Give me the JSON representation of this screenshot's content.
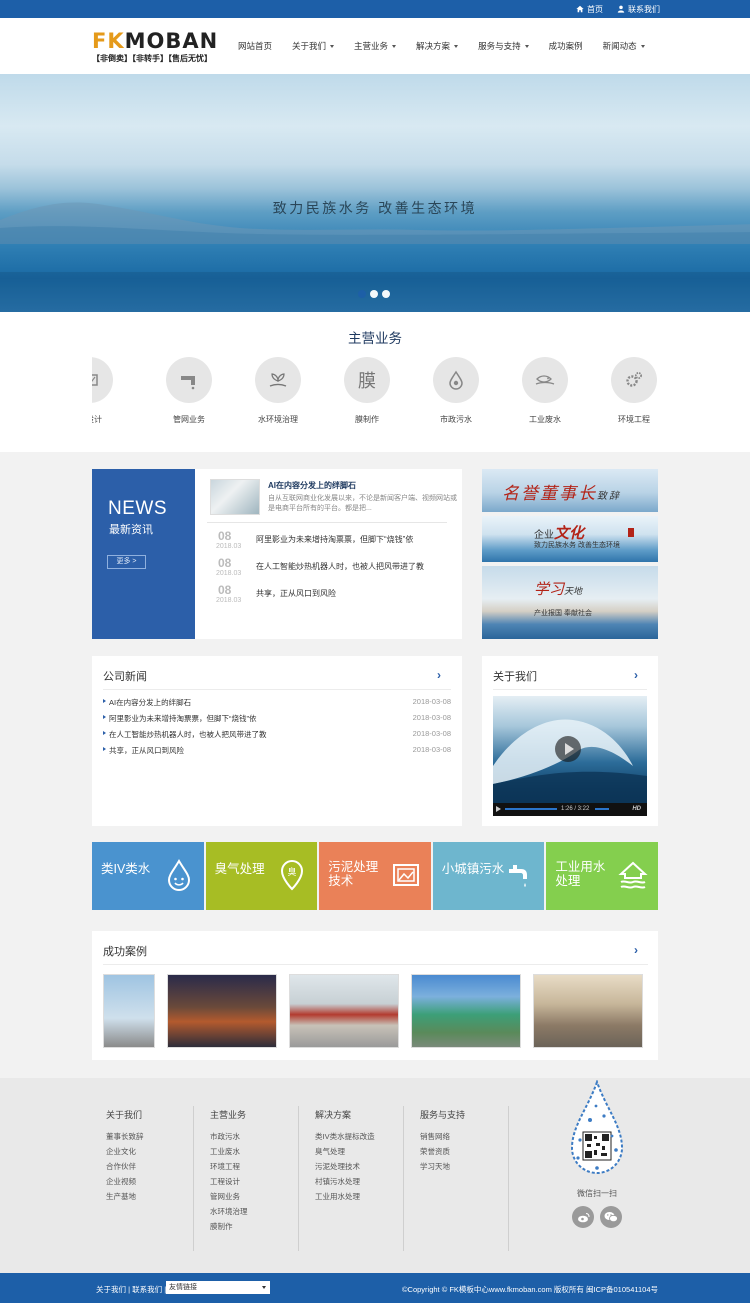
{
  "topbar": {
    "home": "首页",
    "contact": "联系我们"
  },
  "logo": {
    "brand_fk": "FK",
    "brand_rest": "MOBAN",
    "slogan": "【非倒卖】【非转手】【售后无忧】"
  },
  "nav": [
    {
      "label": "网站首页",
      "dropdown": false
    },
    {
      "label": "关于我们",
      "dropdown": true
    },
    {
      "label": "主营业务",
      "dropdown": true
    },
    {
      "label": "解决方案",
      "dropdown": true
    },
    {
      "label": "服务与支持",
      "dropdown": true
    },
    {
      "label": "成功案例",
      "dropdown": false
    },
    {
      "label": "新闻动态",
      "dropdown": true
    }
  ],
  "banner": {
    "caption": "致力民族水务   改善生态环境",
    "slides": 3,
    "active_slide": 1
  },
  "business": {
    "title": "主营业务",
    "items": [
      {
        "label": "程设计",
        "icon": "drawing-icon"
      },
      {
        "label": "管网业务",
        "icon": "pipe-faucet-icon"
      },
      {
        "label": "水环境治理",
        "icon": "hand-plant-icon"
      },
      {
        "label": "膜制作",
        "icon": "membrane-glyph",
        "glyph": "膜"
      },
      {
        "label": "市政污水",
        "icon": "water-drop-icon"
      },
      {
        "label": "工业废水",
        "icon": "fish-water-icon"
      },
      {
        "label": "环境工程",
        "icon": "gears-icon"
      }
    ]
  },
  "news": {
    "heading_en": "NEWS",
    "heading_cn": "最新资讯",
    "more": "更多 >",
    "featured": {
      "title": "AI在内容分发上的绊脚石",
      "summary": "自从互联网商业化发展以来，不论是新闻客户端、视频网站或是电商平台所有的平台。都是把..."
    },
    "items": [
      {
        "day": "08",
        "ym": "2018.03",
        "title": "阿里影业为未来增持淘票票，但脚下“烧钱”依"
      },
      {
        "day": "08",
        "ym": "2018.03",
        "title": "在人工智能炒热机器人时，也被人把风带进了教"
      },
      {
        "day": "08",
        "ym": "2018.03",
        "title": "共享，正从风口到风险"
      }
    ]
  },
  "side_pics": {
    "p1": {
      "text": "名誉董事长",
      "suffix": "致辞"
    },
    "p2": {
      "prefix": "企业",
      "big": "文化",
      "sub": "致力民族水务   改善生态环境"
    },
    "p3": {
      "big": "学习",
      "suffix": "天地",
      "sub": "产业报国   奉献社会"
    }
  },
  "company_news": {
    "title": "公司新闻",
    "arrow": "›",
    "rows": [
      {
        "title": "AI在内容分发上的绊脚石",
        "date": "2018-03-08"
      },
      {
        "title": "阿里影业为未来增持淘票票，但脚下“烧钱”依",
        "date": "2018-03-08"
      },
      {
        "title": "在人工智能炒热机器人时，也被人把风带进了教",
        "date": "2018-03-08"
      },
      {
        "title": "共享，正从风口到风险",
        "date": "2018-03-08"
      }
    ]
  },
  "about": {
    "title": "关于我们",
    "arrow": "›",
    "video_time": "1:26 / 3:22",
    "hd": "HD",
    "progress": 0.43
  },
  "tiles": [
    {
      "label": "类IV类水",
      "color": "#4a93cf",
      "icon": "smiley-drop-icon"
    },
    {
      "label": "臭气处理",
      "color": "#a7bd24",
      "icon": "map-pin-icon"
    },
    {
      "label": "污泥处理技术",
      "line1": "污泥处理",
      "line2": "技术",
      "color": "#ea8158",
      "icon": "image-frame-icon"
    },
    {
      "label": "小城镇污水",
      "color": "#6eb6ce",
      "icon": "faucet-icon"
    },
    {
      "label": "工业用水处理",
      "line1": "工业用水",
      "line2": "处理",
      "color": "#84cf4e",
      "icon": "house-water-icon"
    }
  ],
  "cases": {
    "title": "成功案例",
    "arrow": "›"
  },
  "footer": {
    "cols": [
      {
        "title": "关于我们",
        "items": [
          "董事长致辞",
          "企业文化",
          "合作伙伴",
          "企业视频",
          "生产基地"
        ]
      },
      {
        "title": "主营业务",
        "items": [
          "市政污水",
          "工业废水",
          "环境工程",
          "工程设计",
          "管网业务",
          "水环境治理",
          "膜制作"
        ]
      },
      {
        "title": "解决方案",
        "items": [
          "类IV类水提标改造",
          "臭气处理",
          "污泥处理技术",
          "村镇污水处理",
          "工业用水处理"
        ]
      },
      {
        "title": "服务与支持",
        "items": [
          "销售网络",
          "荣誉资质",
          "学习天地"
        ]
      }
    ],
    "qr_caption": "微信扫一扫"
  },
  "bottom": {
    "links": "关于我们  |  联系我们  |",
    "select": "友情链接",
    "copyright": "©Copyright © FK模板中心www.fkmoban.com 版权所有  闽ICP备010541104号"
  }
}
